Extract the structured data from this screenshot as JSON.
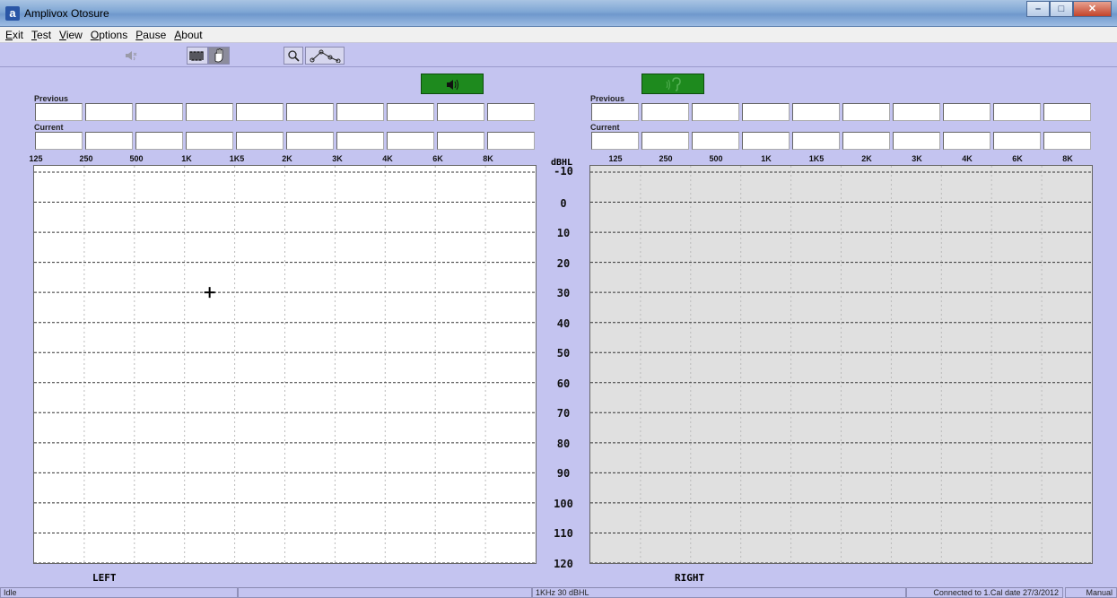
{
  "window": {
    "title": "Amplivox Otosure",
    "app_icon_letter": "a",
    "controls": [
      "minimize",
      "maximize",
      "close"
    ]
  },
  "menu": [
    "Exit",
    "Test",
    "View",
    "Options",
    "Pause",
    "About"
  ],
  "toolbar": {
    "buttons": [
      "speaker-off-icon",
      "tone-hand-icon",
      "magnifier-icon",
      "graph-line-icon"
    ]
  },
  "audiogram": {
    "previous_label": "Previous",
    "current_label": "Current",
    "frequencies": [
      "125",
      "250",
      "500",
      "1K",
      "1K5",
      "2K",
      "3K",
      "4K",
      "6K",
      "8K"
    ],
    "db_unit": "dBHL",
    "db_ticks": [
      "-10",
      "0",
      "10",
      "20",
      "30",
      "40",
      "50",
      "60",
      "70",
      "80",
      "90",
      "100",
      "110",
      "120"
    ],
    "left": {
      "label": "LEFT",
      "active": true,
      "marker": {
        "frequency": "1K",
        "level_dbhl": 30
      }
    },
    "right": {
      "label": "RIGHT",
      "active": false
    },
    "colors": {
      "active_button": "#1e8a1e",
      "inactive_chart_bg": "#e0e0e0",
      "background": "#c4c4f0"
    }
  },
  "status": {
    "state": "Idle",
    "tone": "1KHz 30 dBHL",
    "connection": "Connected to 1.Cal date 27/3/2012",
    "mode": "Manual"
  }
}
